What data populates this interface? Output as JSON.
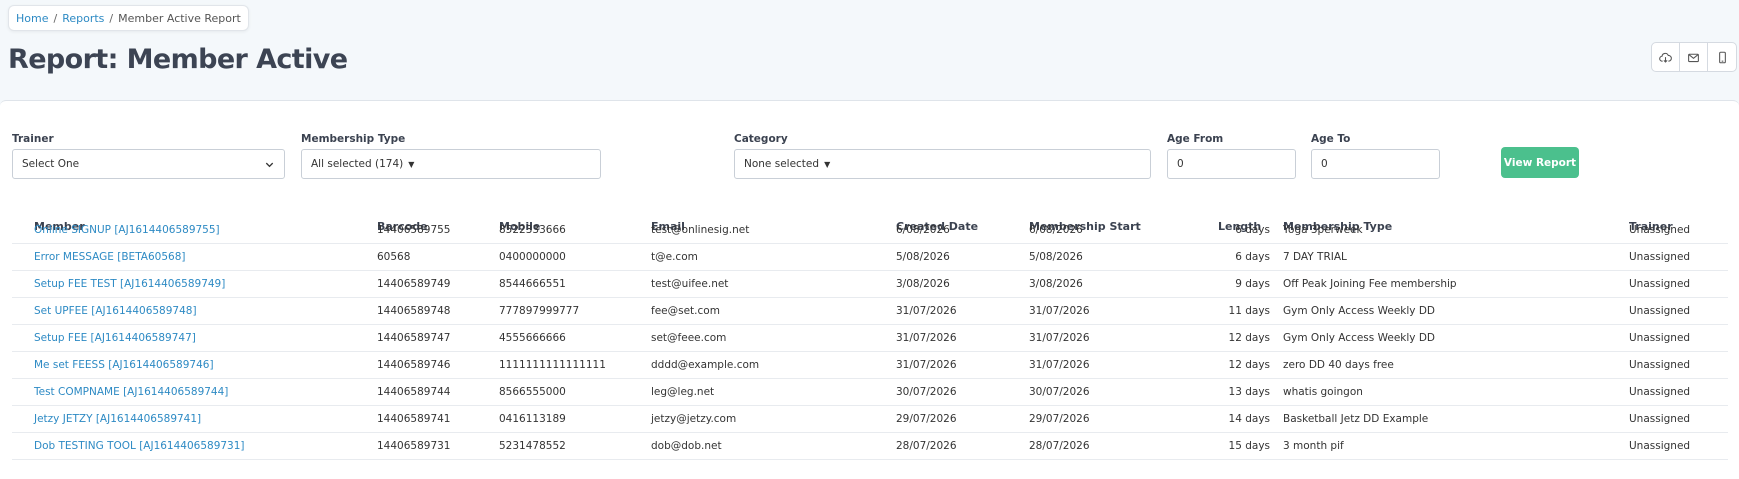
{
  "breadcrumb": {
    "home": "Home",
    "reports": "Reports",
    "current": "Member Active Report",
    "sep": "/"
  },
  "page": {
    "title": "Report: Member Active"
  },
  "actions": [
    {
      "name": "cloud-download-icon"
    },
    {
      "name": "envelope-icon"
    },
    {
      "name": "mobile-icon"
    }
  ],
  "filters": {
    "trainer": {
      "label": "Trainer",
      "value": "Select One"
    },
    "membership_type": {
      "label": "Membership Type",
      "value": "All selected (174)"
    },
    "category": {
      "label": "Category",
      "value": "None selected"
    },
    "age_from": {
      "label": "Age From",
      "value": "0"
    },
    "age_to": {
      "label": "Age To",
      "value": "0"
    },
    "view_button": "View Report"
  },
  "table": {
    "headers": [
      "Member",
      "Barcode",
      "Mobile",
      "Email",
      "Created Date",
      "Membership Start",
      "Length",
      "Membership Type",
      "Trainer"
    ],
    "rows": [
      [
        "Online SIGNUP [AJ1614406589755]",
        "14406589755",
        "8522333666",
        "test@onlinesig.net",
        "6/08/2026",
        "6/08/2026",
        "6 days",
        "Yoga 3perweek",
        "Unassigned"
      ],
      [
        "Error MESSAGE [BETA60568]",
        "60568",
        "0400000000",
        "t@e.com",
        "5/08/2026",
        "5/08/2026",
        "6 days",
        "7 DAY TRIAL",
        "Unassigned"
      ],
      [
        "Setup FEE TEST [AJ1614406589749]",
        "14406589749",
        "8544666551",
        "test@uifee.net",
        "3/08/2026",
        "3/08/2026",
        "9 days",
        "Off Peak Joining Fee membership",
        "Unassigned"
      ],
      [
        "Set UPFEE [AJ1614406589748]",
        "14406589748",
        "777897999777",
        "fee@set.com",
        "31/07/2026",
        "31/07/2026",
        "11 days",
        "Gym Only Access Weekly DD",
        "Unassigned"
      ],
      [
        "Setup FEE [AJ1614406589747]",
        "14406589747",
        "4555666666",
        "set@feee.com",
        "31/07/2026",
        "31/07/2026",
        "12 days",
        "Gym Only Access Weekly DD",
        "Unassigned"
      ],
      [
        "Me set FEESS [AJ1614406589746]",
        "14406589746",
        "1111111111111111",
        "dddd@example.com",
        "31/07/2026",
        "31/07/2026",
        "12 days",
        "zero DD 40 days free",
        "Unassigned"
      ],
      [
        "Test COMPNAME [AJ1614406589744]",
        "14406589744",
        "8566555000",
        "leg@leg.net",
        "30/07/2026",
        "30/07/2026",
        "13 days",
        "whatis goingon",
        "Unassigned"
      ],
      [
        "Jetzy JETZY [AJ1614406589741]",
        "14406589741",
        "0416113189",
        "jetzy@jetzy.com",
        "29/07/2026",
        "29/07/2026",
        "14 days",
        "Basketball Jetz DD Example",
        "Unassigned"
      ],
      [
        "Dob TESTING TOOL [AJ1614406589731]",
        "14406589731",
        "5231478552",
        "dob@dob.net",
        "28/07/2026",
        "28/07/2026",
        "15 days",
        "3 month pif",
        "Unassigned"
      ]
    ]
  }
}
